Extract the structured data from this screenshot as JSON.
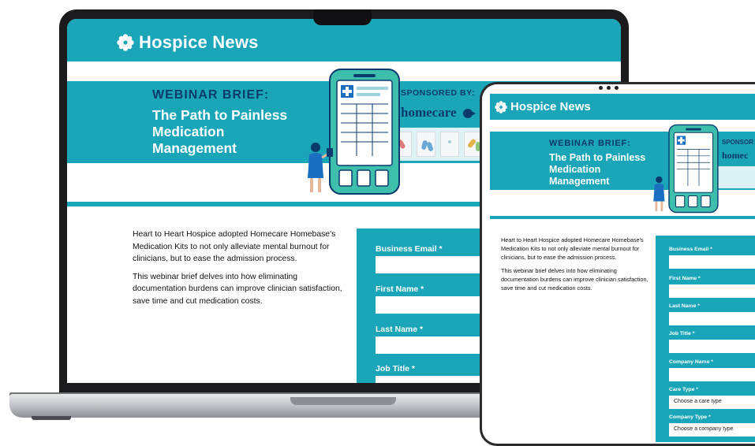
{
  "colors": {
    "brand_teal": "#1aa6b8",
    "navy": "#0b3a6e",
    "white": "#ffffff"
  },
  "laptop": {
    "brand": "Hospice News",
    "kicker": "WEBINAR BRIEF:",
    "title": "The Path to Painless Medication Management",
    "sponsor_label": "SPONSORED BY:",
    "sponsor_logo": "homecare",
    "body": [
      "Heart to Heart Hospice adopted Homecare Homebase's Medication Kits to not only alleviate mental burnout for clinicians, but to ease the admission process.",
      "This webinar brief delves into how eliminating documentation burdens can improve clinician satisfaction, save time and cut medication costs."
    ],
    "form": {
      "email_label": "Business Email *",
      "first_label": "First Name *",
      "last_label": "Last Name *",
      "job_label": "Job Title *"
    }
  },
  "tablet": {
    "brand": "Hospice News",
    "kicker": "WEBINAR BRIEF:",
    "title": "The Path to Painless Medication Management",
    "sponsor_label": "SPONSOR",
    "sponsor_logo": "homec",
    "body": [
      "Heart to Heart Hospice adopted Homecare Homebase's Medication Kits to not only alleviate mental burnout for clinicians, but to ease the admission process.",
      "This webinar brief delves into how eliminating documentation burdens can improve clinician satisfaction, save time and cut medication costs."
    ],
    "form": {
      "email_label": "Business Email *",
      "first_label": "First Name *",
      "last_label": "Last Name *",
      "job_label": "Job Title *",
      "company_label": "Company Name *",
      "care_label": "Care Type *",
      "care_value": "Choose a care type",
      "company_type_label": "Company Type *",
      "company_type_value": "Choose a company type"
    }
  },
  "icons": [
    "flower-logo-icon",
    "phone-illustration-icon",
    "person-illustration-icon",
    "pill-kit-icon"
  ]
}
